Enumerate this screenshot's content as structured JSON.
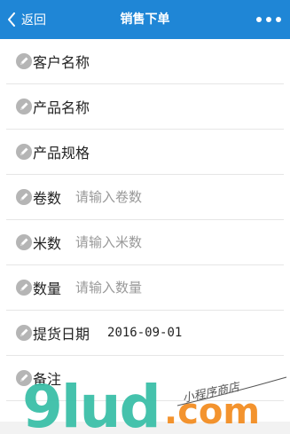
{
  "navbar": {
    "back_label": "返回",
    "title": "销售下单",
    "accent_color": "#1f86d6"
  },
  "form": {
    "rows": [
      {
        "label": "客户名称",
        "icon": "pencil-icon"
      },
      {
        "label": "产品名称",
        "icon": "pencil-icon"
      },
      {
        "label": "产品规格",
        "icon": "pencil-icon"
      },
      {
        "label": "卷数",
        "icon": "pencil-icon",
        "placeholder": "请输入卷数"
      },
      {
        "label": "米数",
        "icon": "pencil-icon",
        "placeholder": "请输入米数"
      },
      {
        "label": "数量",
        "icon": "pencil-icon",
        "placeholder": "请输入数量"
      },
      {
        "label": "提货日期",
        "icon": "pencil-icon",
        "value": "2016-09-01"
      },
      {
        "label": "备注",
        "icon": "pencil-icon"
      }
    ]
  },
  "watermark": {
    "brand": "9lud",
    "domain": ".com",
    "tagline": "小程序商店",
    "colors": {
      "teal": "#3bbfa8",
      "orange": "#f28a1c"
    }
  }
}
